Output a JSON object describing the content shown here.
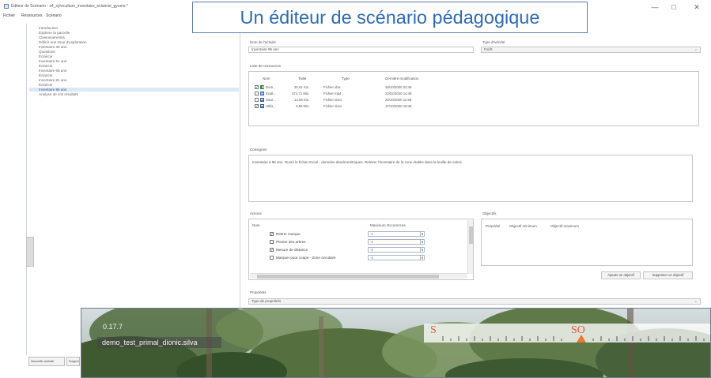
{
  "window": {
    "title": "Éditeur de Scénario - s4_sylviculture_inventaire_eclaircie_gyumo *",
    "controls": {
      "minimize": "—",
      "maximize": "◻",
      "close": "✕"
    }
  },
  "menu": [
    "Fichier",
    "Ressources",
    "Scénario"
  ],
  "banner": "Un éditeur de scénario pédagogique",
  "activities": {
    "items": [
      "Introduction",
      "Explorer la parcelle",
      "Cloisonnements",
      "Définir une zone d'exploration",
      "Inventaire 38 ans",
      "Questions",
      "Éclaircie",
      "Inventaire 51 ans",
      "Éclaircie",
      "Inventaire 66 ans",
      "Éclaircie",
      "Inventaire 81 ans",
      "Éclaircie",
      "Inventaire 96 ans",
      "Analyse de vos résultats"
    ],
    "selected_index": 13
  },
  "bottom_buttons": [
    "Nouvelle activité",
    "Supprimer"
  ],
  "detail": {
    "name_label": "Nom de l'activité",
    "name_value": "Inventaire 96 ans",
    "type_label": "Type d'activité",
    "type_value": "Forêt",
    "resources_label": "Liste de ressources",
    "resources_columns": [
      "Nom",
      "Taille",
      "Type",
      "Dernière modification"
    ],
    "resources": [
      {
        "checked": true,
        "icon": "green",
        "name": "Dom...",
        "size": "20,01 Kio",
        "type": "Fichier xlsx",
        "date": "18/10/2020 22:46"
      },
      {
        "checked": false,
        "icon": "blue",
        "name": "Ecial...",
        "size": "374,71 Mio",
        "type": "Fichier mp4",
        "date": "22/02/2020 14:49"
      },
      {
        "checked": false,
        "icon": "blue",
        "name": "Suivi...",
        "size": "14,06 Kio",
        "type": "Fichier docx",
        "date": "20/10/2020 11:59"
      },
      {
        "checked": true,
        "icon": "blue",
        "name": "Utilis...",
        "size": "3,58 Mio",
        "type": "Fichier docx",
        "date": "17/10/2020 18:46"
      }
    ],
    "consignes_label": "Consignes",
    "consignes_text": "Inventaire à 96 ans. Ouvrir le fichier Excel - données dendrométriques. Relever l'inventaire de la zone établie dans la feuille de calcul.",
    "actions_label": "Actions",
    "actions_columns": [
      "Nom",
      "Maximum Occurences"
    ],
    "actions": [
      {
        "checked": true,
        "name": "Retirer marque",
        "max": "-1"
      },
      {
        "checked": false,
        "name": "Planter des arbres",
        "max": "-1"
      },
      {
        "checked": true,
        "name": "Mesure de distance",
        "max": "-1"
      },
      {
        "checked": false,
        "name": "Marquer pour coupe - Zone circulaire",
        "max": "-1"
      }
    ],
    "objectifs_label": "Objectifs",
    "objectifs_columns": [
      "Propriété",
      "Objectif minimum",
      "Objectif maximum"
    ],
    "add_objective_button": "Ajouter un objectif",
    "remove_objective_button": "Supprimer un objectif",
    "properties_label": "Propriétés",
    "properties_value": "Type de propriétés"
  },
  "simulation": {
    "version": "0.17.7",
    "username": "demo_test_primal_dionic.silva",
    "compass": {
      "left_label": "S",
      "center_label": "SO"
    }
  },
  "colors": {
    "banner_text": "#2f6bb4",
    "selection_background": "#dde8f6",
    "compass_accent": "#e2573b",
    "compass_needle": "#e87a33"
  }
}
